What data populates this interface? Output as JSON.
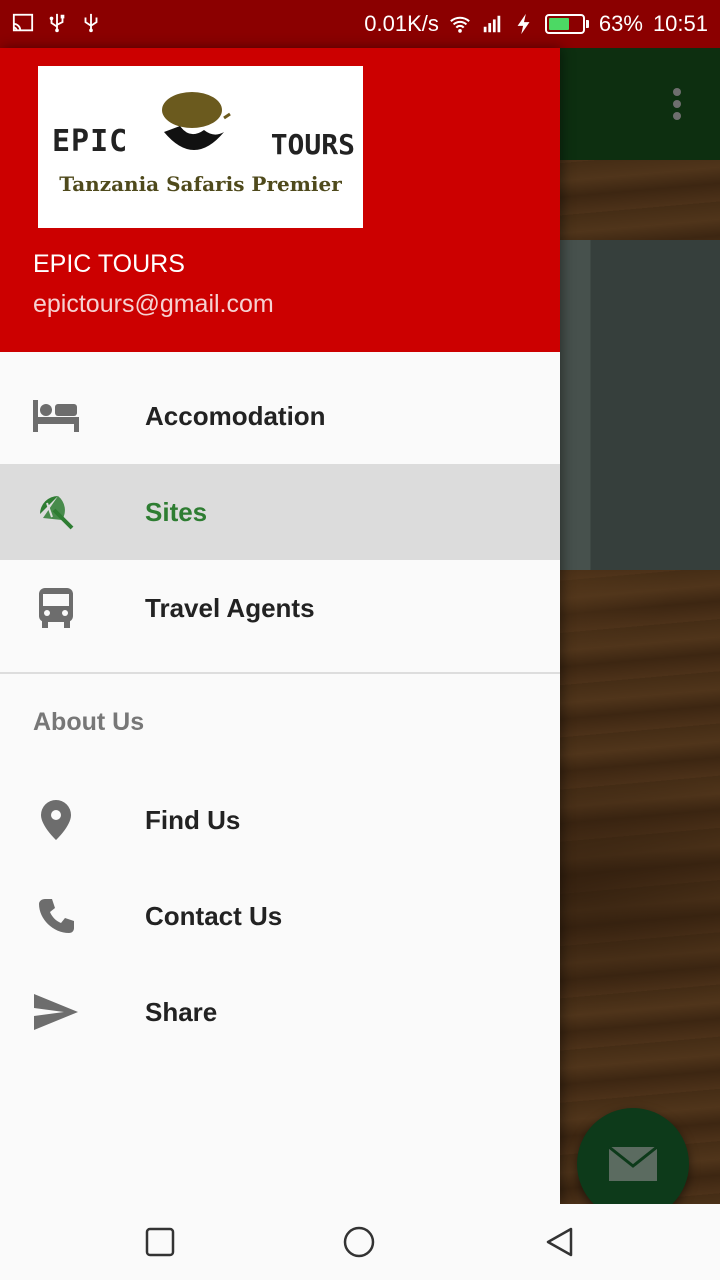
{
  "status_bar": {
    "network_speed": "0.01K/s",
    "battery_percent": "63%",
    "battery_level": 0.63,
    "time": "10:51",
    "icons": [
      "cast-icon",
      "usb-icon",
      "usb-icon",
      "wifi-icon",
      "signal-icon",
      "charging-icon",
      "battery-icon"
    ]
  },
  "drawer": {
    "logo": {
      "left_text": "EPIC",
      "right_text": "TOURS",
      "tagline": "Tanzania Safaris Premier"
    },
    "account_name": "EPIC TOURS",
    "account_email": "epictours@gmail.com",
    "items": [
      {
        "label": "Accomodation",
        "icon": "hotel-bed-icon",
        "selected": false
      },
      {
        "label": "Sites",
        "icon": "beach-umbrella-icon",
        "selected": true
      },
      {
        "label": "Travel Agents",
        "icon": "bus-icon",
        "selected": false
      }
    ],
    "section_title": "About Us",
    "section_items": [
      {
        "label": "Find Us",
        "icon": "location-pin-icon"
      },
      {
        "label": "Contact Us",
        "icon": "phone-icon"
      },
      {
        "label": "Share",
        "icon": "send-icon"
      }
    ]
  },
  "colors": {
    "header_red": "#cc0000",
    "status_bar": "#8b0000",
    "selected_accent": "#2e7d32",
    "toolbar_green": "#1b5e20"
  },
  "nav_bar": {
    "buttons": [
      "recents-square-icon",
      "home-circle-icon",
      "back-triangle-icon"
    ]
  }
}
